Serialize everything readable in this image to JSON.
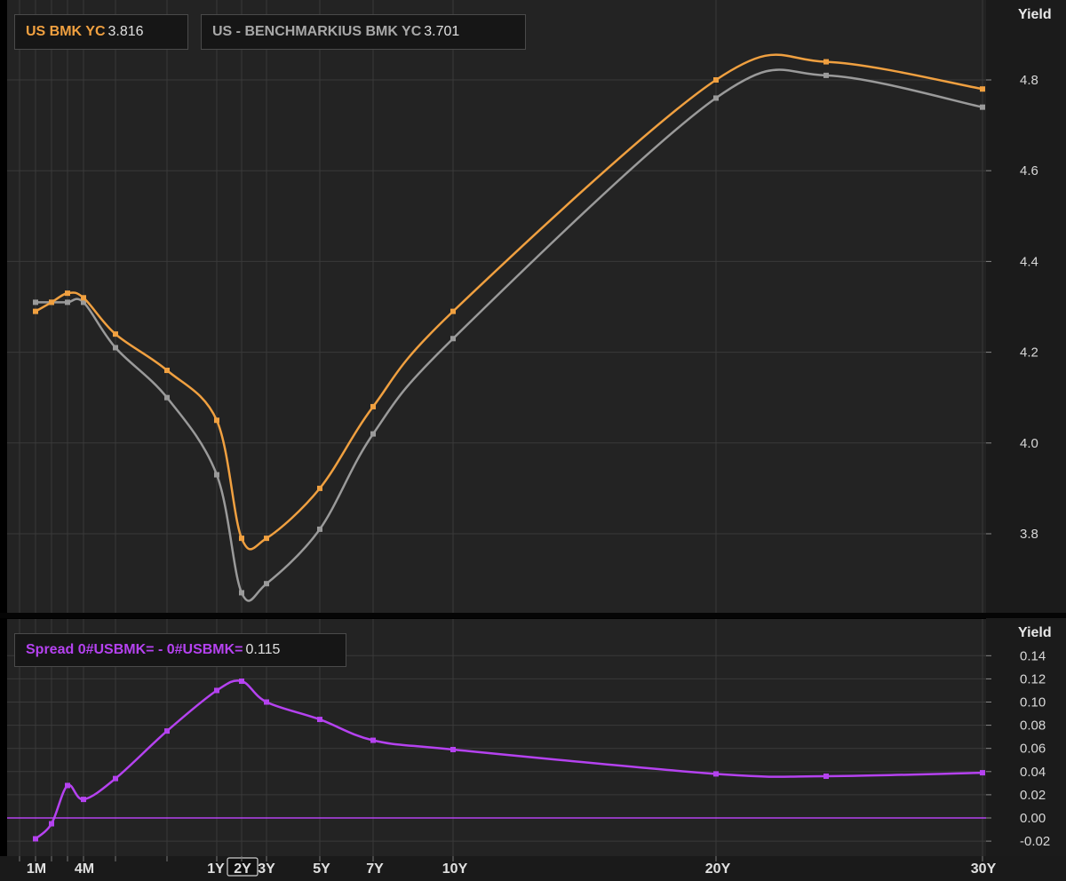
{
  "colors": {
    "orange": "#f0a040",
    "gray": "#9a9a9a",
    "purple": "#b542f0",
    "grid": "#3a3a3a",
    "panel_bg": "#232323"
  },
  "legends": {
    "top": [
      {
        "name": "US BMK YC",
        "value": "3.816",
        "color": "#f0a040"
      },
      {
        "name": "US - BENCHMARKIUS BMK YC",
        "value": "3.701",
        "color": "#a8a8a8"
      }
    ],
    "bottom": {
      "name": "Spread 0#USBMK= - 0#USBMK=",
      "value": "0.115",
      "color": "#b542f0"
    }
  },
  "x_axis": {
    "labels": [
      "1M",
      "4M",
      "1Y",
      "2Y",
      "3Y",
      "5Y",
      "7Y",
      "10Y",
      "20Y",
      "30Y"
    ],
    "highlighted": "2Y"
  },
  "chart_data": [
    {
      "type": "line",
      "ylabel": "Yield",
      "ylim": [
        3.65,
        4.85
      ],
      "yticks": [
        "3.8",
        "4.0",
        "4.2",
        "4.4",
        "4.6",
        "4.8"
      ],
      "grid": true,
      "legend": "top-left",
      "x": [
        "1M",
        "2M",
        "3M",
        "4M",
        "6M",
        "9M",
        "1Y",
        "2Y",
        "3Y",
        "5Y",
        "7Y",
        "10Y",
        "20Y",
        "25Y",
        "30Y"
      ],
      "series": [
        {
          "name": "US BMK YC",
          "values": [
            4.29,
            4.31,
            4.33,
            4.32,
            4.24,
            4.16,
            4.05,
            3.79,
            3.79,
            3.9,
            4.08,
            4.29,
            4.8,
            4.84,
            4.78
          ]
        },
        {
          "name": "US - BENCHMARKIUS BMK YC",
          "values": [
            4.31,
            4.31,
            4.31,
            4.31,
            4.21,
            4.1,
            3.93,
            3.67,
            3.69,
            3.81,
            4.02,
            4.23,
            4.76,
            4.81,
            4.74
          ]
        }
      ]
    },
    {
      "type": "line",
      "ylabel": "Yield",
      "ylim": [
        -0.025,
        0.145
      ],
      "yticks": [
        "-0.02",
        "0.00",
        "0.02",
        "0.04",
        "0.06",
        "0.08",
        "0.10",
        "0.12",
        "0.14"
      ],
      "grid": true,
      "legend": "top-left",
      "x": [
        "1M",
        "2M",
        "3M",
        "4M",
        "6M",
        "9M",
        "1Y",
        "2Y",
        "3Y",
        "5Y",
        "7Y",
        "10Y",
        "20Y",
        "25Y",
        "30Y"
      ],
      "series": [
        {
          "name": "Spread 0#USBMK= - 0#USBMK=",
          "values": [
            -0.018,
            -0.005,
            0.028,
            0.016,
            0.034,
            0.075,
            0.11,
            0.118,
            0.1,
            0.085,
            0.067,
            0.059,
            0.038,
            0.036,
            0.039
          ]
        }
      ]
    }
  ]
}
